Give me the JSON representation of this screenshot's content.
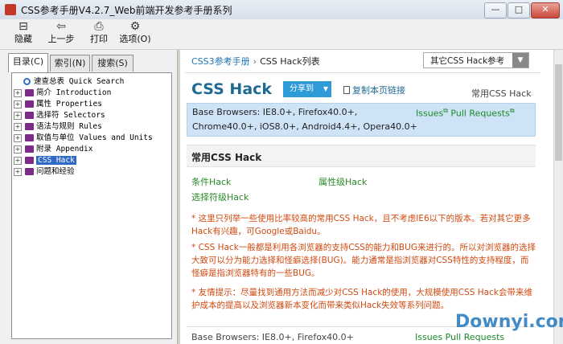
{
  "window": {
    "title": "CSS参考手册V4.2.7_Web前端开发参考手册系列",
    "min_glyph": "—",
    "max_glyph": "□",
    "close_glyph": "✕"
  },
  "toolbar": {
    "items": [
      {
        "icon": "hide-icon",
        "glyph": "⊟",
        "label": "隐藏"
      },
      {
        "icon": "back-arrow-icon",
        "glyph": "⇦",
        "label": "上一步"
      },
      {
        "icon": "print-icon",
        "glyph": "⎙",
        "label": "打印"
      },
      {
        "icon": "options-icon",
        "glyph": "⚙",
        "label": "选项(O)"
      }
    ]
  },
  "tabs": [
    "目录(C)",
    "索引(N)",
    "搜索(S)"
  ],
  "tree": [
    {
      "label": "速查总表 Quick Search",
      "kind": "search",
      "expandable": false,
      "selected": false
    },
    {
      "label": "简介 Introduction",
      "kind": "book",
      "expandable": true,
      "selected": false
    },
    {
      "label": "属性 Properties",
      "kind": "book",
      "expandable": true,
      "selected": false
    },
    {
      "label": "选择符 Selectors",
      "kind": "book",
      "expandable": true,
      "selected": false
    },
    {
      "label": "语法与规则 Rules",
      "kind": "book",
      "expandable": true,
      "selected": false
    },
    {
      "label": "取值与单位 Values and Units",
      "kind": "book",
      "expandable": true,
      "selected": false
    },
    {
      "label": "附录 Appendix",
      "kind": "book",
      "expandable": true,
      "selected": false
    },
    {
      "label": "CSS Hack",
      "kind": "book",
      "expandable": true,
      "selected": true
    },
    {
      "label": "问题和经验",
      "kind": "book",
      "expandable": true,
      "selected": false
    }
  ],
  "content": {
    "breadcrumb": {
      "root": "CSS3参考手册",
      "sep": "›",
      "current": "CSS Hack列表"
    },
    "select_value": "其它CSS Hack参考",
    "title": "CSS Hack",
    "share_label": "分享到",
    "copy_link_label": "复制本页链接",
    "right_label": "常用CSS Hack",
    "browsers_line1": "Base Browsers: IE8.0+, Firefox40.0+,",
    "browsers_line2": "Chrome40.0+, iOS8.0+, Android4.4+, Opera40.0+",
    "issues": "Issues",
    "pull_requests": "Pull Requests",
    "section_title": "常用CSS Hack",
    "hack_links": [
      "条件Hack",
      "属性级Hack",
      "选择符级Hack"
    ],
    "notes": [
      "* 这里只列举一些使用比率较高的常用CSS Hack，且不考虑IE6以下的版本。若对其它更多Hack有兴趣，可Google或Baidu。",
      "* CSS Hack一般都是利用各浏览器的支持CSS的能力和BUG来进行的。所以对浏览器的选择大致可以分为能力选择和怪癖选择(BUG)。能力通常是指浏览器对CSS特性的支持程度，而怪癖是指浏览器特有的一些BUG。",
      "* 友情提示：尽量找到通用方法而减少对CSS Hack的使用，大规模使用CSS Hack会带来维护成本的提高以及浏览器新本变化而带来类似Hack失效等系列问题。"
    ],
    "bottom_text": "Base Browsers: IE8.0+, Firefox40.0+",
    "bottom_links": "Issues  Pull Requests"
  },
  "watermark": "Downyi.com",
  "colors": {
    "accent": "#1f6a93",
    "note": "#d04a10",
    "link_green": "#2a8a2a",
    "share": "#2e9bd6",
    "info_bg": "#cfe3f7"
  }
}
